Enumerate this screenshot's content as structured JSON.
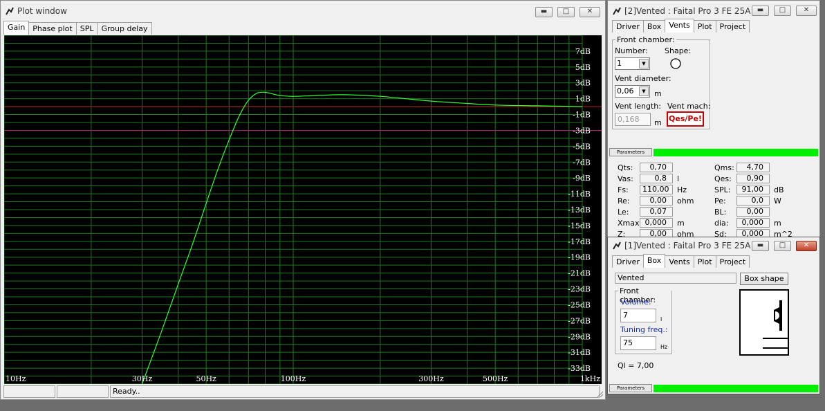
{
  "plot_window": {
    "title": "Plot window",
    "tabs": [
      "Gain",
      "Phase plot",
      "SPL",
      "Group delay"
    ],
    "status": [
      "",
      "",
      "Ready.."
    ]
  },
  "chart_data": {
    "type": "line",
    "x_scale": "log",
    "xlim": [
      10,
      1000
    ],
    "ylim": [
      -35,
      9
    ],
    "x_ticks": [
      {
        "v": 10,
        "label": "10Hz"
      },
      {
        "v": 30,
        "label": "30Hz"
      },
      {
        "v": 50,
        "label": "50Hz"
      },
      {
        "v": 100,
        "label": "100Hz"
      },
      {
        "v": 300,
        "label": "300Hz"
      },
      {
        "v": 500,
        "label": "500Hz"
      },
      {
        "v": 1000,
        "label": "1kHz"
      }
    ],
    "y_ticks": [
      7,
      5,
      3,
      1,
      -1,
      -3,
      -5,
      -7,
      -9,
      -11,
      -13,
      -15,
      -17,
      -19,
      -21,
      -23,
      -25,
      -27,
      -29,
      -31,
      -33
    ],
    "y_tick_labels": [
      "7dB",
      "5dB",
      "3dB",
      "1dB",
      "-1dB",
      "-3dB",
      "-5dB",
      "-7dB",
      "-9dB",
      "-11dB",
      "-13dB",
      "-15dB",
      "-17dB",
      "-19dB",
      "-21dB",
      "-23dB",
      "-25dB",
      "-27dB",
      "-29dB",
      "-31dB",
      "-33dB"
    ],
    "ref_lines": [
      {
        "y": 0,
        "color": "#b81c1c"
      },
      {
        "y": -3,
        "color": "#b01c6c"
      }
    ],
    "grid": true,
    "series": [
      {
        "color": "#33ff33",
        "points": [
          [
            30,
            -35
          ],
          [
            35,
            -28.4
          ],
          [
            40,
            -22.4
          ],
          [
            45,
            -17.2
          ],
          [
            50,
            -12.2
          ],
          [
            55,
            -7.8
          ],
          [
            60,
            -4.2
          ],
          [
            65,
            -1.2
          ],
          [
            70,
            0.8
          ],
          [
            75,
            1.7
          ],
          [
            80,
            1.8
          ],
          [
            85,
            1.6
          ],
          [
            90,
            1.4
          ],
          [
            100,
            1.3
          ],
          [
            120,
            1.4
          ],
          [
            150,
            1.5
          ],
          [
            200,
            1.3
          ],
          [
            300,
            0.7
          ],
          [
            400,
            0.4
          ],
          [
            500,
            0.2
          ],
          [
            700,
            0.1
          ],
          [
            1000,
            0
          ]
        ]
      }
    ]
  },
  "vents_window": {
    "title": "[2]Vented : Faital Pro 3 FE 25A",
    "tabs": [
      "Driver",
      "Box",
      "Vents",
      "Plot",
      "Project"
    ],
    "front_chamber_label": "Front chamber:",
    "number_label": "Number:",
    "number_value": "1",
    "shape_label": "Shape:",
    "vent_diameter_label": "Vent diameter:",
    "vent_diameter_value": "0,06",
    "vent_diameter_unit": "m",
    "vent_length_label": "Vent length:",
    "vent_length_value": "0,168",
    "vent_length_unit": "m",
    "vent_mach_label": "Vent mach:",
    "vent_mach_button": "Qes/Pe!",
    "parameters_tab": "Parameters",
    "params": [
      {
        "label": "Qts:",
        "value": "0,70",
        "unit": ""
      },
      {
        "label": "Vas:",
        "value": "0,8",
        "unit": "l"
      },
      {
        "label": "Fs:",
        "value": "110,00",
        "unit": "Hz"
      },
      {
        "label": "Re:",
        "value": "0,00",
        "unit": "ohm"
      },
      {
        "label": "Le:",
        "value": "0,07",
        "unit": ""
      },
      {
        "label": "Xmax:",
        "value": "0,000",
        "unit": "m"
      },
      {
        "label": "Z:",
        "value": "0,00",
        "unit": "ohm"
      }
    ],
    "params_right": [
      {
        "label": "Qms:",
        "value": "4,70",
        "unit": ""
      },
      {
        "label": "Qes:",
        "value": "0,90",
        "unit": ""
      },
      {
        "label": "SPL:",
        "value": "91,00",
        "unit": "dB"
      },
      {
        "label": "Pe:",
        "value": "0,0",
        "unit": "W"
      },
      {
        "label": "BL:",
        "value": "0,00",
        "unit": ""
      },
      {
        "label": "dia:",
        "value": "0,000",
        "unit": "m"
      },
      {
        "label": "Sd:",
        "value": "0,000",
        "unit": "m^2"
      }
    ]
  },
  "box_window": {
    "title": "[1]Vented : Faital Pro 3 FE 25A",
    "tabs": [
      "Driver",
      "Box",
      "Vents",
      "Plot",
      "Project"
    ],
    "box_type": "Vented",
    "box_shape_button": "Box shape",
    "front_chamber_label": "Front chamber:",
    "volume_label": "Volume:",
    "volume_value": "7",
    "volume_unit": "l",
    "tuning_label": "Tuning freq.:",
    "tuning_value": "75",
    "tuning_unit": "Hz",
    "ql_text": "Ql = 7,00",
    "parameters_tab": "Parameters"
  },
  "colors": {
    "plot_bg": "#000000",
    "grid": "#1e7a1e",
    "curve": "#33ff33",
    "param_bar": "#00ee00"
  }
}
